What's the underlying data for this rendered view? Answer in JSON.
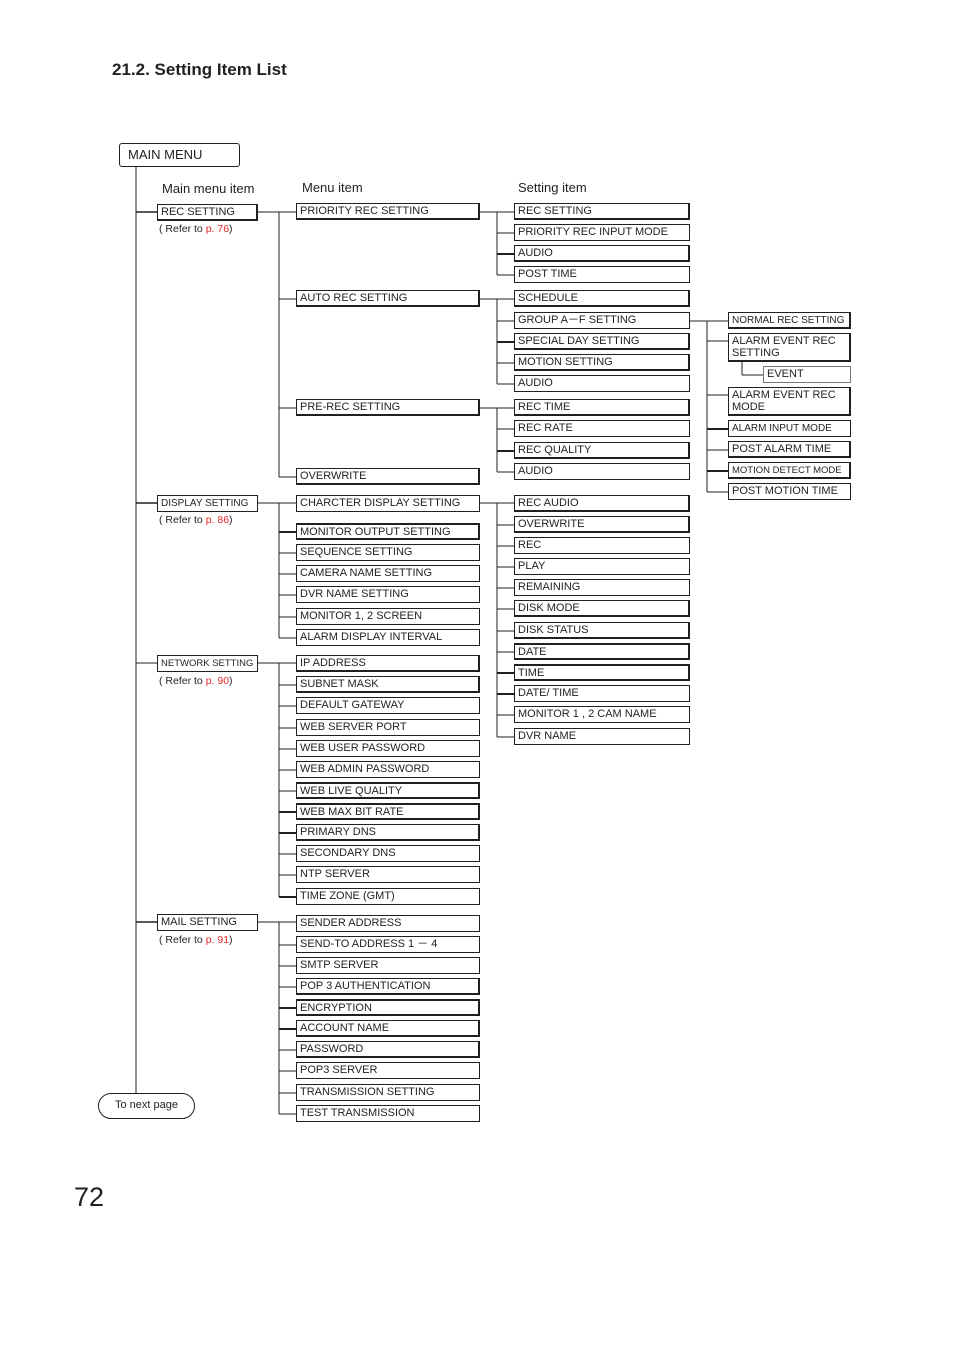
{
  "page": {
    "section_title": "21.2. Setting Item List",
    "page_number": "72"
  },
  "headers": {
    "main_menu_item": "Main menu item",
    "menu_item": "Menu item",
    "setting_item": "Setting item"
  },
  "root": {
    "label": "MAIN  MENU"
  },
  "next_page": {
    "label": "To next page"
  },
  "main_items": [
    {
      "label": "REC  SETTING",
      "refer_prefix": "( Refer to ",
      "refer_page": "p. 76",
      "refer_suffix": ")"
    },
    {
      "label": "DISPLAY  SETTING",
      "refer_prefix": "( Refer to ",
      "refer_page": "p. 86",
      "refer_suffix": ")"
    },
    {
      "label": "NETWORK  SETTING",
      "refer_prefix": "( Refer to ",
      "refer_page": "p. 90",
      "refer_suffix": ")"
    },
    {
      "label": "MAIL  SETTING",
      "refer_prefix": "( Refer to ",
      "refer_page": "p. 91",
      "refer_suffix": ")"
    }
  ],
  "rec_menu": [
    "PRIORITY  REC  SETTING",
    "AUTO  REC  SETTING",
    "PRE-REC  SETTING",
    "OVERWRITE"
  ],
  "priority_rec_settings": [
    "REC  SETTING",
    "PRIORITY  REC  INPUT  MODE",
    "AUDIO",
    "POST  TIME"
  ],
  "auto_rec_settings": [
    "SCHEDULE",
    "GROUP A－F  SETTING",
    "SPECIAL  DAY  SETTING",
    "MOTION  SETTING",
    "AUDIO"
  ],
  "group_settings": [
    "NORMAL  REC  SETTING",
    "ALARM  EVENT REC  SETTING",
    "EVENT",
    "ALARM  EVENT REC  MODE",
    "ALARM  INPUT  MODE",
    "POST  ALARM  TIME",
    "MOTION  DETECT  MODE",
    "POST  MOTION  TIME"
  ],
  "pre_rec_settings": [
    "REC  TIME",
    "REC  RATE",
    "REC  QUALITY",
    "AUDIO"
  ],
  "display_menu": [
    "CHARCTER  DISPLAY  SETTING",
    "MONITOR  OUTPUT  SETTING",
    "SEQUENCE  SETTING",
    "CAMERA  NAME  SETTING",
    "DVR  NAME  SETTING",
    "MONITOR 1, 2 SCREEN",
    "ALARM  DISPLAY  INTERVAL"
  ],
  "character_display_settings": [
    "REC  AUDIO",
    "OVERWRITE",
    "REC",
    "PLAY",
    "REMAINING",
    "DISK  MODE",
    "DISK  STATUS",
    "DATE",
    "TIME",
    "DATE/ TIME",
    "MONITOR 1 , 2 CAM  NAME",
    "DVR  NAME"
  ],
  "network_menu": [
    "IP  ADDRESS",
    "SUBNET  MASK",
    "DEFAULT  GATEWAY",
    "WEB  SERVER  PORT",
    "WEB  USER  PASSWORD",
    "WEB  ADMIN  PASSWORD",
    "WEB  LIVE  QUALITY",
    "WEB  MAX  BIT  RATE",
    "PRIMARY  DNS",
    "SECONDARY  DNS",
    "NTP  SERVER",
    "TIME  ZONE (GMT)"
  ],
  "mail_menu": [
    "SENDER  ADDRESS",
    "SEND-TO  ADDRESS 1 －  4",
    "SMTP  SERVER",
    "POP 3  AUTHENTICATION",
    "ENCRYPTION",
    "ACCOUNT  NAME",
    "PASSWORD",
    "POP3  SERVER",
    "TRANSMISSION  SETTING",
    "TEST  TRANSMISSION"
  ]
}
